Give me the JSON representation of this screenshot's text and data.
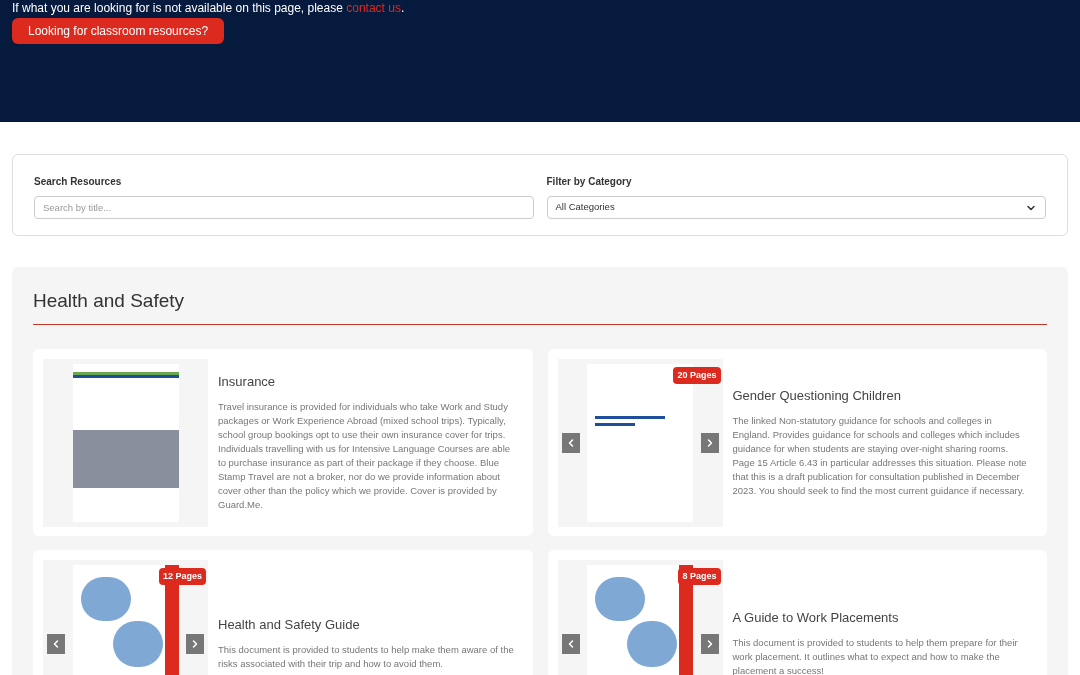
{
  "hero": {
    "notice": "If what you are looking for is not available on this page, please ",
    "notice_link": "contact us",
    "notice_end": ".",
    "button": "Looking for classroom resources?"
  },
  "filters": {
    "search_label": "Search Resources",
    "search_placeholder": "Search by title...",
    "category_label": "Filter by Category",
    "category_value": "All Categories"
  },
  "section": {
    "title": "Health and Safety",
    "resources": [
      {
        "title": "Insurance",
        "description": "Travel insurance is provided for individuals who take Work and Study packages or Work Experience Abroad (mixed school trips). Typically, school group bookings opt to use their own insurance cover for trips. Individuals travelling with us for Intensive Language Courses are able to purchase insurance as part of their package if they choose. Blue Stamp Travel are not a broker, nor do we provide information about cover other than the policy which we provide. Cover is provided by Guard.Me.",
        "arrows": false,
        "kind": "policy"
      },
      {
        "title": "Gender Questioning Children",
        "description": "The linked Non-statutory guidance for schools and colleges in England. Provides guidance for schools and colleges which includes guidance for when students are staying over-night sharing rooms. Page 15 Article 6.43 in particular addresses this situation. Please note that this is a draft publication for consultation published in December 2023. You should seek to find the most current guidance if necessary.",
        "badge": "20 Pages",
        "arrows": true,
        "kind": "plain"
      },
      {
        "title": "Health and Safety Guide",
        "description": "This document is provided to students to help make them aware of the risks associated with their trip and how to avoid them.",
        "badge": "12 Pages",
        "arrows": true,
        "kind": "guide"
      },
      {
        "title": "A Guide to Work Placements",
        "description": "This document is provided to students to help them prepare for their work placement. It outlines what to expect and how to make the placement a success!",
        "badge": "8 Pages",
        "arrows": true,
        "kind": "guide"
      }
    ]
  }
}
